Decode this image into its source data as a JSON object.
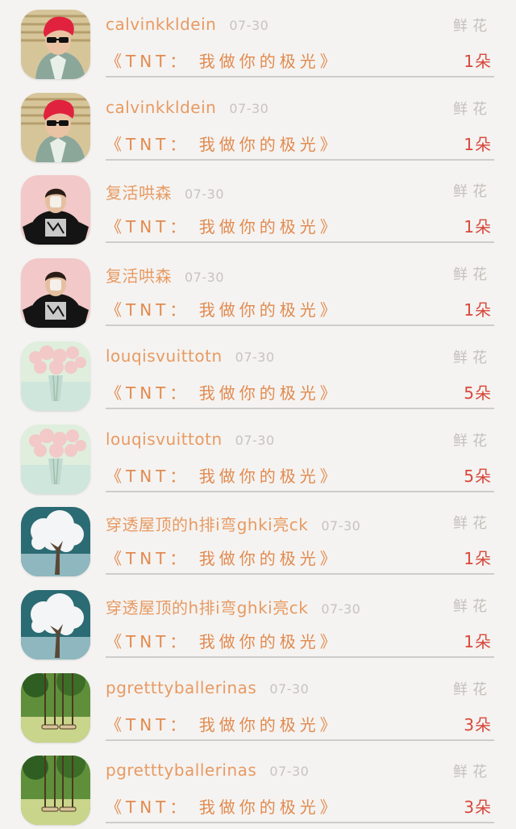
{
  "gift_records": [
    {
      "user": "calvinkkldein",
      "date": "07-30",
      "gift_type": "鲜花",
      "gift": "《TNT： 我做你的极光》",
      "count": "1朵",
      "avatar": "red-hair-sunglasses-man-avatar"
    },
    {
      "user": "calvinkkldein",
      "date": "07-30",
      "gift_type": "鲜花",
      "gift": "《TNT： 我做你的极光》",
      "count": "1朵",
      "avatar": "red-hair-sunglasses-man-avatar"
    },
    {
      "user": "复活哄森",
      "date": "07-30",
      "gift_type": "鲜花",
      "gift": "《TNT： 我做你的极光》",
      "count": "1朵",
      "avatar": "black-hoodie-person-avatar"
    },
    {
      "user": "复活哄森",
      "date": "07-30",
      "gift_type": "鲜花",
      "gift": "《TNT： 我做你的极光》",
      "count": "1朵",
      "avatar": "black-hoodie-person-avatar"
    },
    {
      "user": "louqisvuittotn",
      "date": "07-30",
      "gift_type": "鲜花",
      "gift": "《TNT： 我做你的极光》",
      "count": "5朵",
      "avatar": "flower-vase-avatar"
    },
    {
      "user": "louqisvuittotn",
      "date": "07-30",
      "gift_type": "鲜花",
      "gift": "《TNT： 我做你的极光》",
      "count": "5朵",
      "avatar": "flower-vase-avatar"
    },
    {
      "user": "穿透屋顶的h排i弯ghki亮ck",
      "date": "07-30",
      "gift_type": "鲜花",
      "gift": "《TNT： 我做你的极光》",
      "count": "1朵",
      "avatar": "white-tree-avatar"
    },
    {
      "user": "穿透屋顶的h排i弯ghki亮ck",
      "date": "07-30",
      "gift_type": "鲜花",
      "gift": "《TNT： 我做你的极光》",
      "count": "1朵",
      "avatar": "white-tree-avatar"
    },
    {
      "user": "pgretttyballerinas",
      "date": "07-30",
      "gift_type": "鲜花",
      "gift": "《TNT： 我做你的极光》",
      "count": "3朵",
      "avatar": "swing-park-avatar"
    },
    {
      "user": "pgretttyballerinas",
      "date": "07-30",
      "gift_type": "鲜花",
      "gift": "《TNT： 我做你的极光》",
      "count": "3朵",
      "avatar": "swing-park-avatar"
    }
  ],
  "colors": {
    "background": "#f4f3f1",
    "username": "#e89a62",
    "gift_name": "#e28a4f",
    "count": "#d9463a",
    "muted": "#c4c0bc",
    "divider": "#cfcdca"
  }
}
